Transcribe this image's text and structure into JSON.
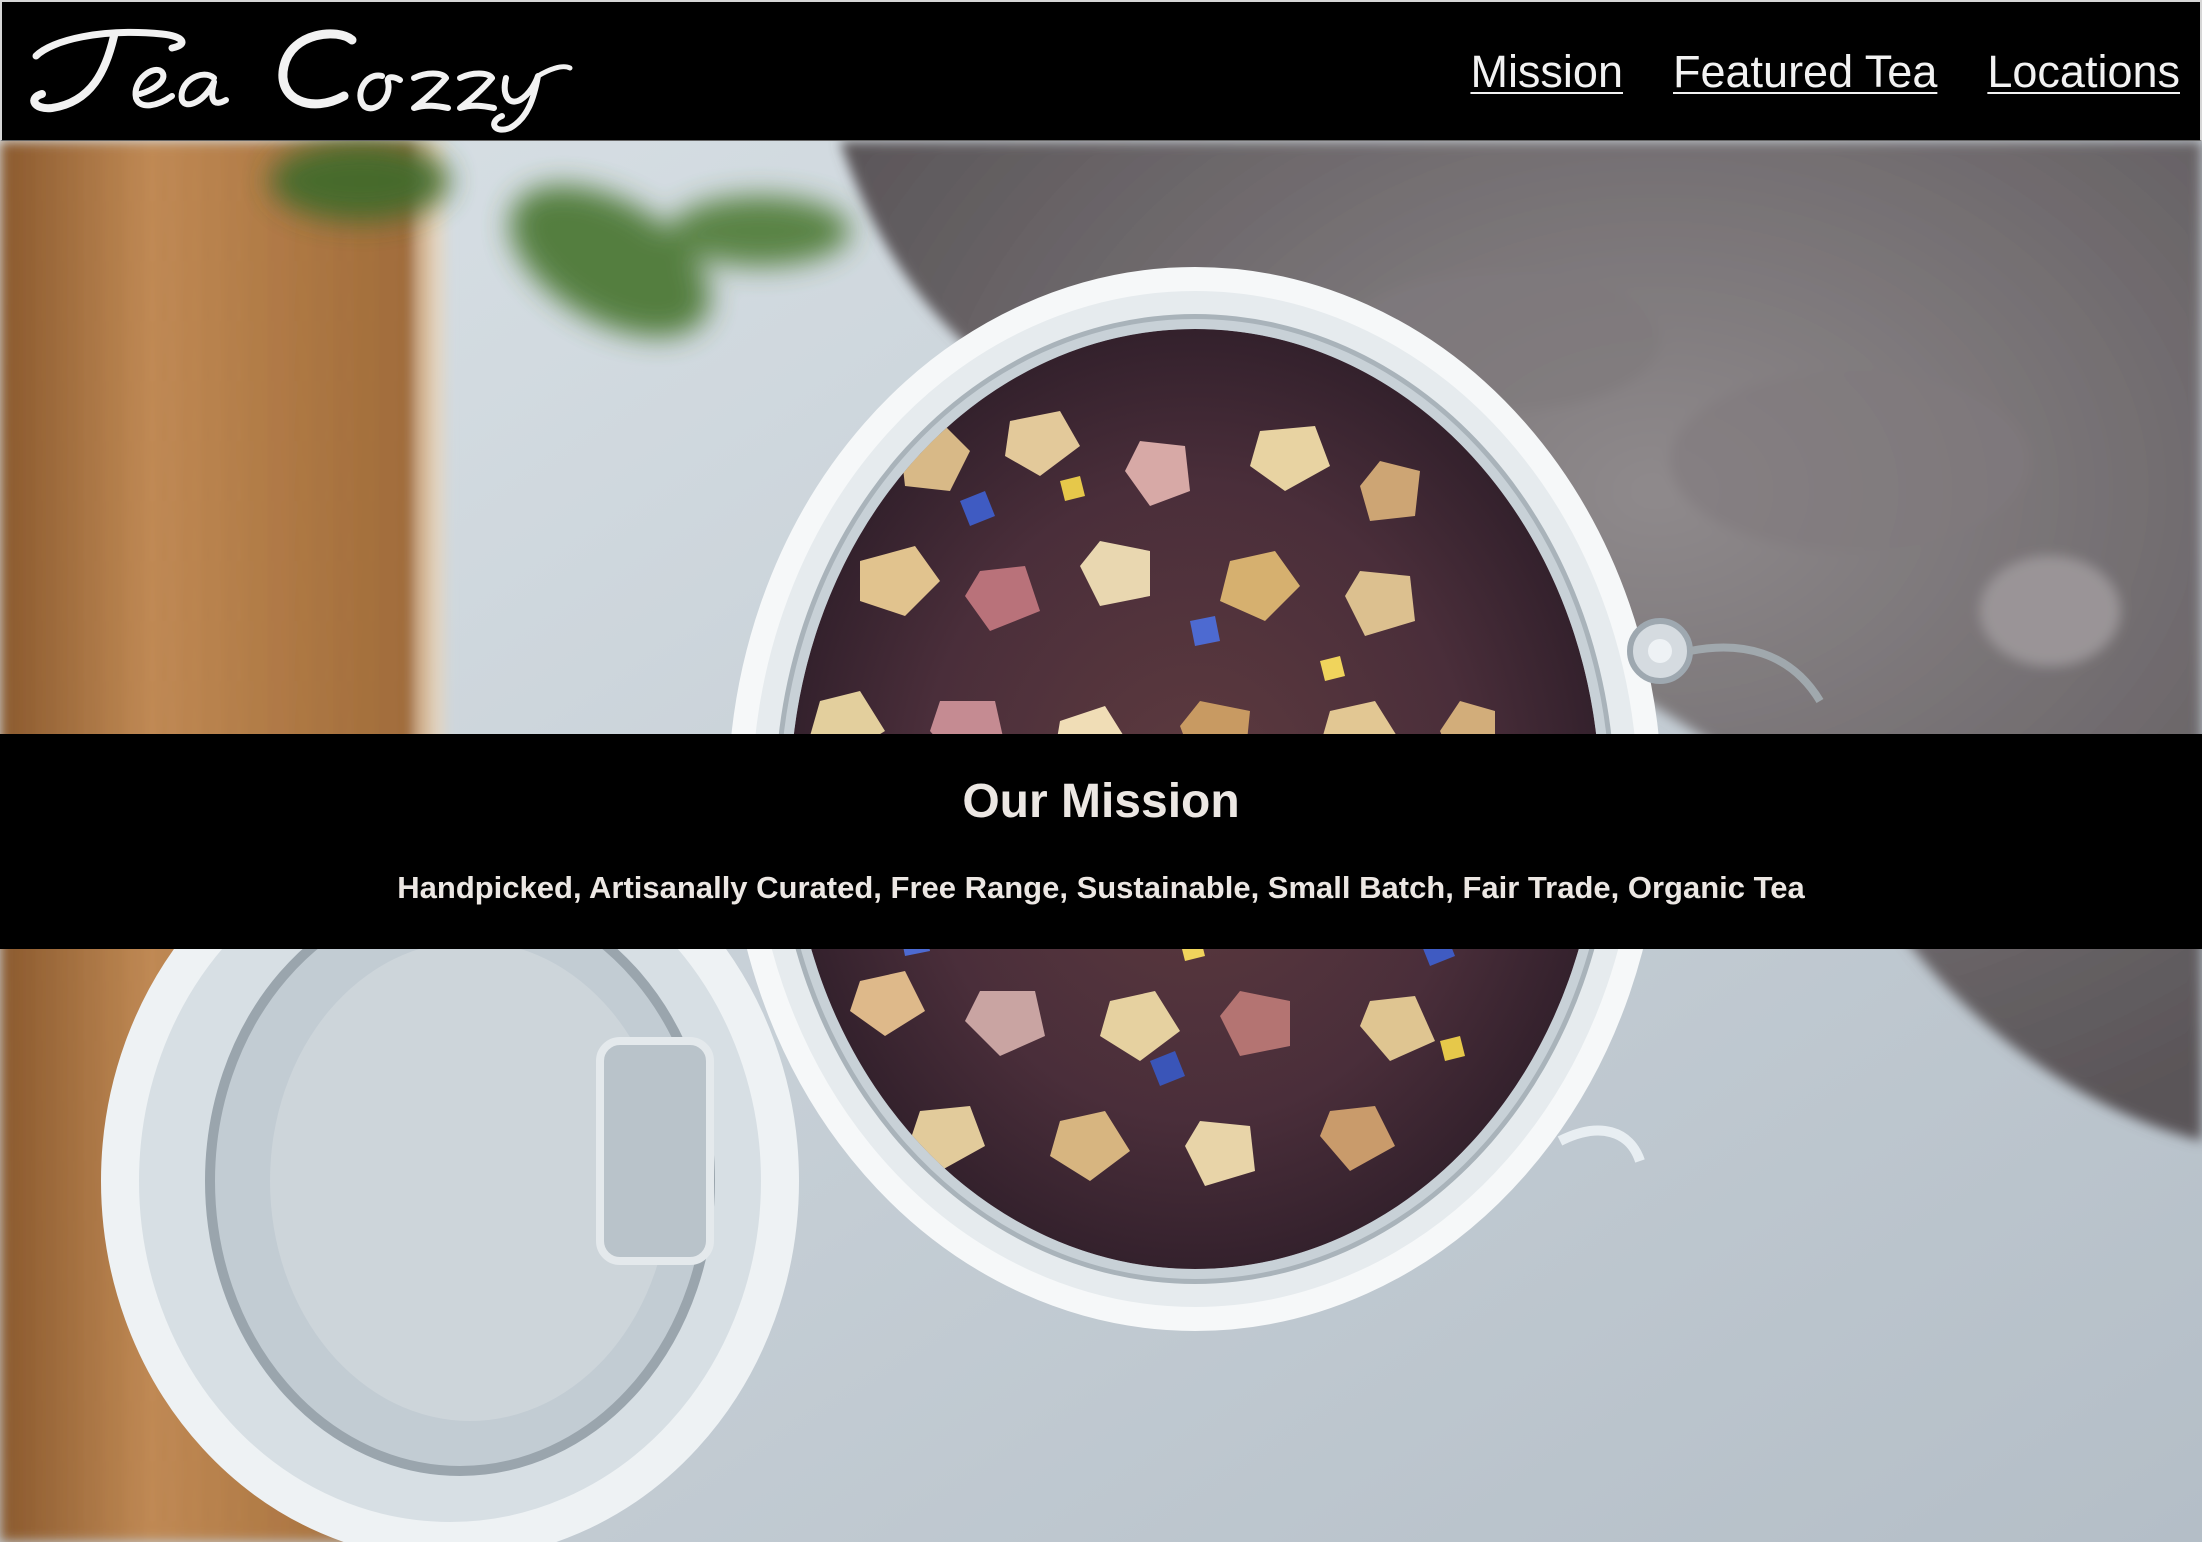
{
  "header": {
    "logo_text": "Tea Cozy",
    "nav": [
      {
        "label": "Mission"
      },
      {
        "label": "Featured Tea"
      },
      {
        "label": "Locations"
      }
    ]
  },
  "hero": {
    "image": "tea-jar-photo"
  },
  "mission": {
    "title": "Our Mission",
    "tagline": "Handpicked, Artisanally Curated, Free Range, Sustainable, Small Batch, Fair Trade, Organic Tea"
  },
  "colors": {
    "header_bg": "#000000",
    "text_light": "#ece7e3"
  }
}
